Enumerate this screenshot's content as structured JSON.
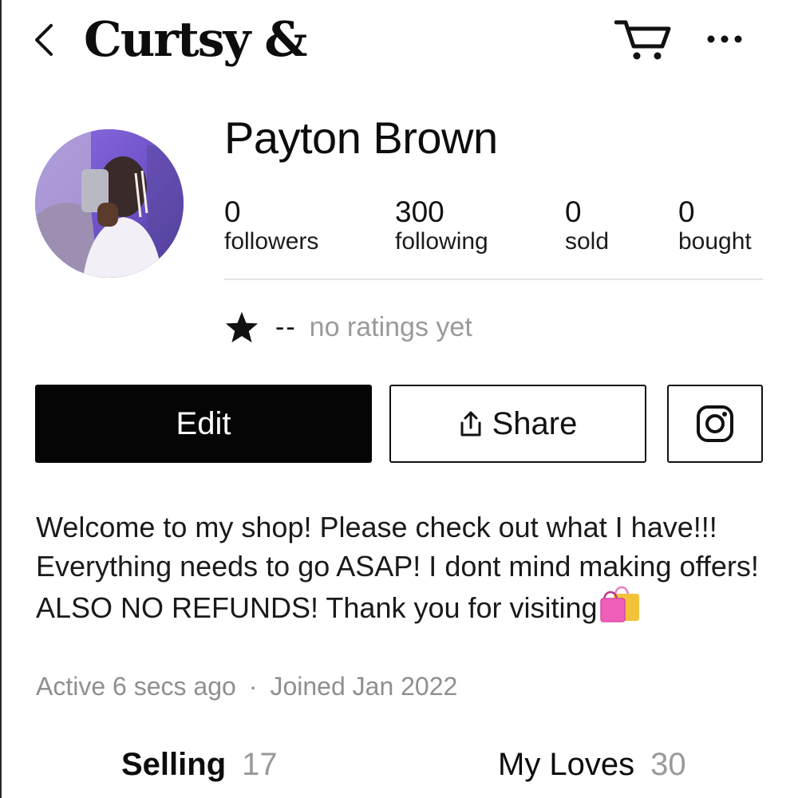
{
  "header": {
    "logo_text": "Curtsy &",
    "back_icon": "chevron-left-icon",
    "cart_icon": "shopping-cart-icon",
    "more_icon": "more-horizontal-icon"
  },
  "profile": {
    "name": "Payton Brown",
    "stats": [
      {
        "value": "0",
        "label": "followers"
      },
      {
        "value": "300",
        "label": "following"
      },
      {
        "value": "0",
        "label": "sold"
      },
      {
        "value": "0",
        "label": "bought"
      }
    ],
    "rating": {
      "value": "--",
      "text": "no ratings yet",
      "icon": "star-icon"
    }
  },
  "actions": {
    "edit_label": "Edit",
    "share_label": "Share",
    "share_icon": "share-upload-icon",
    "instagram_icon": "instagram-icon"
  },
  "bio": {
    "text": "Welcome to my shop! Please check out what I have!!! Everything needs to go ASAP! I dont mind making offers! ALSO NO REFUNDS! Thank you for visiting",
    "emoji_icon": "shopping-bags-icon",
    "active": "Active 6 secs ago",
    "separator": "·",
    "joined": "Joined Jan 2022"
  },
  "tabs": [
    {
      "label": "Selling",
      "count": "17"
    },
    {
      "label": "My Loves",
      "count": "30"
    }
  ],
  "colors": {
    "primary": "#050505",
    "muted_text": "#9a9a9a",
    "divider": "#e2e2e2",
    "avatar_bg": "#7b5fd1"
  }
}
